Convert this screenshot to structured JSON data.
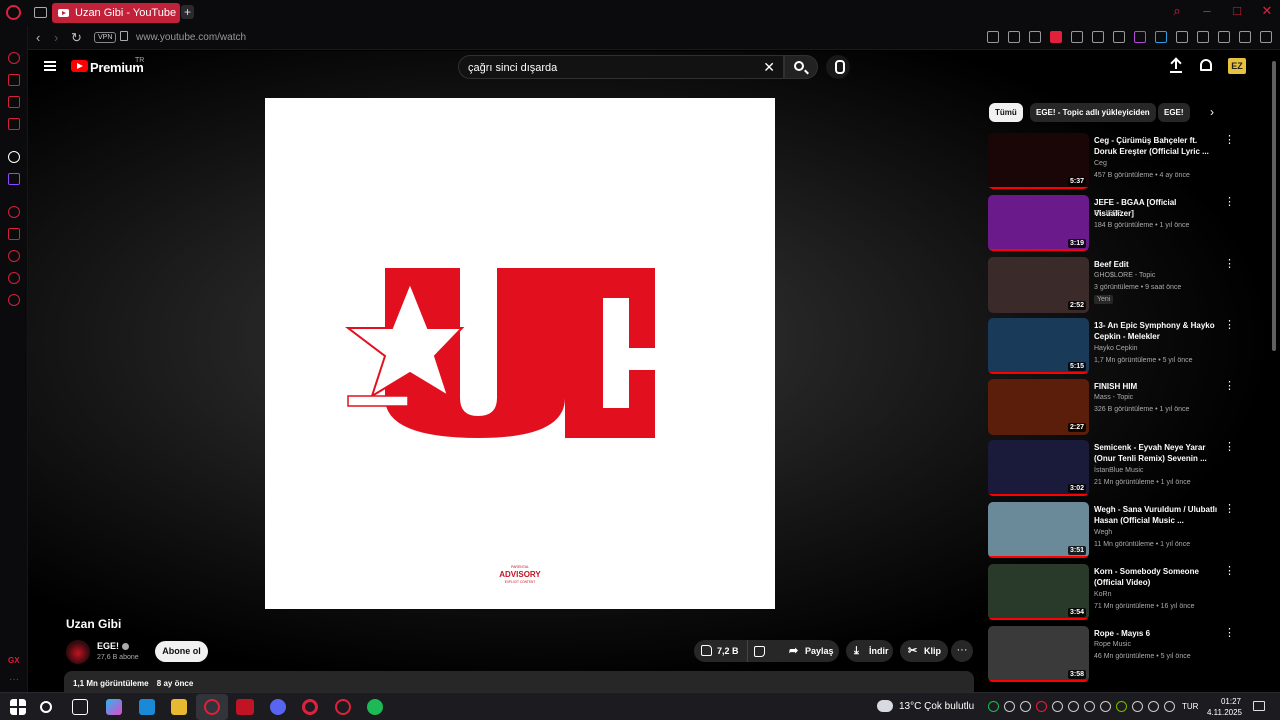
{
  "browser": {
    "tab_title": "Uzan Gibi - YouTube",
    "new_tab": "+",
    "vpn": "VPN",
    "url": "www.youtube.com/watch"
  },
  "sidebar": {
    "gx_label": "GX",
    "more": "···"
  },
  "yt": {
    "brand": "Premium",
    "region": "TR",
    "search_value": "çağrı sinci dışarda",
    "account_initials": "EZ"
  },
  "video": {
    "title": "Uzan Gibi",
    "channel": "EGE!",
    "subscribers": "27,6 B abone",
    "subscribe_label": "Abone ol",
    "likes": "7,2 B",
    "share_label": "Paylaş",
    "download_label": "İndir",
    "clip_label": "Klip",
    "views": "1,1 Mn görüntüleme",
    "age": "8 ay önce",
    "art_text": "UG",
    "advisory_top": "PARENTAL",
    "advisory_main": "ADVISORY",
    "advisory_bottom": "EXPLICIT CONTENT"
  },
  "chips": [
    "Tümü",
    "EGE! - Topic adlı yükleyiciden",
    "EGE!"
  ],
  "recommendations": [
    {
      "title": "Ceg - Çürümüş Bahçeler ft. Doruk Ereşter (Official Lyric ...",
      "channel": "Ceg",
      "meta": "457 B görüntüleme • 4 ay önce",
      "duration": "5:37",
      "color": "#1a0606",
      "badge": ""
    },
    {
      "title": "JEFE - BGAA [Official Visualizer]",
      "channel": "EL JEFE",
      "meta": "184 B görüntüleme • 1 yıl önce",
      "duration": "3:19",
      "color": "#6a1a8a",
      "badge": ""
    },
    {
      "title": "Beef Edit",
      "channel": "GHO$LORE - Topic",
      "meta": "3 görüntüleme • 9 saat önce",
      "duration": "2:52",
      "color": "#3a2a2a",
      "badge": "Yeni"
    },
    {
      "title": "13- An Epic Symphony & Hayko Cepkin - Melekler",
      "channel": "Hayko Cepkin",
      "meta": "1,7 Mn görüntüleme • 5 yıl önce",
      "duration": "5:15",
      "color": "#1a3a5a",
      "badge": ""
    },
    {
      "title": "FINISH HIM",
      "channel": "Mass - Topic",
      "meta": "326 B görüntüleme • 1 yıl önce",
      "duration": "2:27",
      "color": "#5a1e0a",
      "badge": ""
    },
    {
      "title": "Semicenk - Eyvah Neye Yarar (Onur Tenli Remix) Sevenin ...",
      "channel": "İstanBlue Music",
      "meta": "21 Mn görüntüleme • 1 yıl önce",
      "duration": "3:02",
      "color": "#1a1a3a",
      "badge": ""
    },
    {
      "title": "Wegh - Sana Vuruldum / Ulubatlı Hasan (Official Music ...",
      "channel": "Wegh",
      "meta": "11 Mn görüntüleme • 1 yıl önce",
      "duration": "3:51",
      "color": "#6a8a9a",
      "badge": ""
    },
    {
      "title": "Korn - Somebody Someone (Official Video)",
      "channel": "KoRn",
      "meta": "71 Mn görüntüleme • 16 yıl önce",
      "duration": "3:54",
      "color": "#2a3a2a",
      "badge": ""
    },
    {
      "title": "Rope - Mayıs 6",
      "channel": "Rope Music",
      "meta": "46 Mn görüntüleme • 5 yıl önce",
      "duration": "3:58",
      "color": "#3a3a3a",
      "badge": ""
    }
  ],
  "taskbar": {
    "weather": "13°C  Çok bulutlu",
    "lang": "TUR",
    "time": "01:27",
    "date": "4.11.2025"
  }
}
